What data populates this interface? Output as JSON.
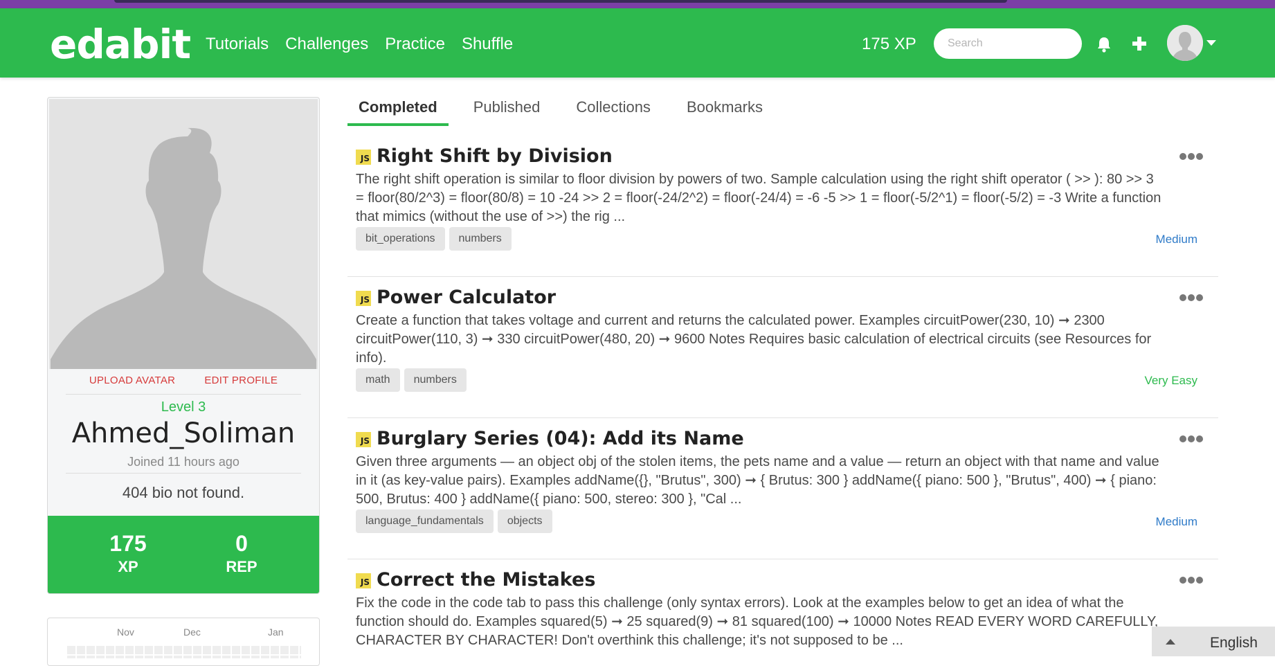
{
  "brand": {
    "logo": "edabit"
  },
  "nav": {
    "links": [
      "Tutorials",
      "Challenges",
      "Practice",
      "Shuffle"
    ],
    "xp": "175 XP",
    "search_placeholder": "Search"
  },
  "profile": {
    "upload_avatar": "UPLOAD AVATAR",
    "edit_profile": "EDIT PROFILE",
    "level": "Level 3",
    "username": "Ahmed_Soliman",
    "joined": "Joined 11 hours ago",
    "bio": "404 bio not found.",
    "xp_value": "175",
    "xp_label": "XP",
    "rep_value": "0",
    "rep_label": "REP"
  },
  "activity": {
    "months": [
      "Nov",
      "Dec",
      "Jan"
    ]
  },
  "tabs": [
    "Completed",
    "Published",
    "Collections",
    "Bookmarks"
  ],
  "challenges": [
    {
      "badge": "JS",
      "title": "Right Shift by Division",
      "description": "The right shift operation is similar to floor division by powers of two. Sample calculation using the right shift operator ( >> ): 80 >> 3 = floor(80/2^3) = floor(80/8) = 10 -24 >> 2 = floor(-24/2^2) = floor(-24/4) = -6 -5 >> 1 = floor(-5/2^1) = floor(-5/2) = -3 Write a function that mimics (without the use of >>) the rig ...",
      "tags": [
        "bit_operations",
        "numbers"
      ],
      "difficulty": "Medium"
    },
    {
      "badge": "JS",
      "title": "Power Calculator",
      "description": "Create a function that takes voltage and current and returns the calculated power. Examples circuitPower(230, 10) ➞ 2300 circuitPower(110, 3) ➞ 330 circuitPower(480, 20) ➞ 9600 Notes Requires basic calculation of electrical circuits (see Resources for info).",
      "tags": [
        "math",
        "numbers"
      ],
      "difficulty": "Very Easy"
    },
    {
      "badge": "JS",
      "title": "Burglary Series (04): Add its Name",
      "description": "Given three arguments — an object obj of the stolen items, the pets name and a value — return an object with that name and value in it (as key-value pairs). Examples addName({}, \"Brutus\", 300) ➞ { Brutus: 300 } addName({ piano: 500 }, \"Brutus\", 400) ➞ { piano: 500, Brutus: 400 } addName({ piano: 500, stereo: 300 }, \"Cal ...",
      "tags": [
        "language_fundamentals",
        "objects"
      ],
      "difficulty": "Medium"
    },
    {
      "badge": "JS",
      "title": "Correct the Mistakes",
      "description": "Fix the code in the code tab to pass this challenge (only syntax errors). Look at the examples below to get an idea of what the function should do. Examples squared(5) ➞ 25 squared(9) ➞ 81 squared(100) ➞ 10000 Notes READ EVERY WORD CAREFULLY, CHARACTER BY CHARACTER! Don't overthink this challenge; it's not supposed to be ...",
      "tags": [],
      "difficulty": ""
    }
  ],
  "footer": {
    "language": "English"
  },
  "colors": {
    "brand_green": "#2dba4e",
    "top_purple": "#7b3fa6",
    "medium_blue": "#2f7bc8",
    "js_yellow": "#f0db4f"
  }
}
